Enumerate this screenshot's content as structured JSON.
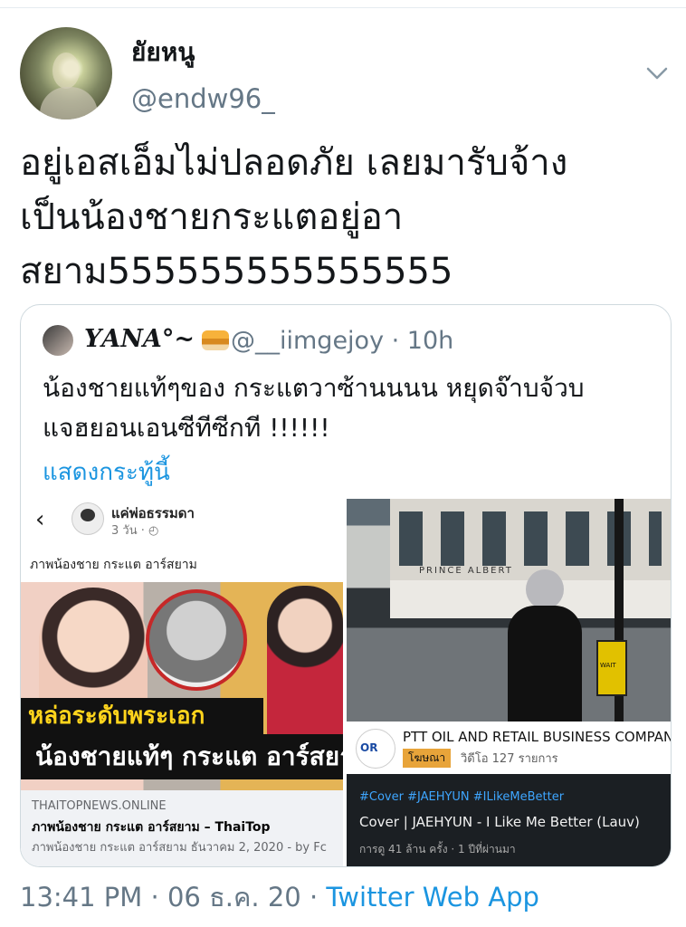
{
  "tweet": {
    "display_name": "ยัยหนู",
    "handle": "@endw96_",
    "text_lines": [
      "อยู่เอสเอ็มไม่ปลอดภัย เลยมารับจ้าง",
      "เป็นน้องชายกระแตอยู่อา",
      "สยาม555555555555555"
    ],
    "timestamp": "13:41 PM · 06 ธ.ค. 20 · ",
    "source": "Twitter Web App"
  },
  "quote": {
    "display_name": "𝒀𝑨𝑵𝑨°~",
    "handle_time": "@__iimgejoy · 10h",
    "text_lines": [
      "น้องชายแท้ๆของ กระแตวาซ้านนนน  หยุดจ๊าบจ้วบ",
      "แจฮยอนเอนซีทีซีกที !!!!!!"
    ],
    "show_more": "แสดงกระทู้นี้"
  },
  "left_card": {
    "page_name": "แค่พ่อธรรมดา",
    "time": "3 วัน · ◴",
    "caption": "ภาพน้องชาย กระแต อาร์สยาม",
    "banner_top": "หล่อระดับพระเอก",
    "banner_bottom": "น้องชายแท้ๆ กระแต อาร์สยาม",
    "domain": "THAITOPNEWS.ONLINE",
    "title": "ภาพน้องชาย กระแต อาร์สยาม – ThaiTop",
    "description": "ภาพน้องชาย กระแต อาร์สยาม ธันวาคม 2, 2020 - by Fc"
  },
  "right_card": {
    "sign": "PRINCE ALBERT",
    "logo_text": "OR",
    "channel_name": "PTT OIL AND RETAIL BUSINESS COMPAN",
    "ad_label": "โฆษณา",
    "video_count": "วิดีโอ 127 รายการ",
    "tags": "#Cover #JAEHYUN #ILikeMeBetter",
    "title": "Cover | JAEHYUN - I Like Me Better (Lauv)",
    "stats": "การดู 41 ล้าน ครั้ง · 1 ปีที่ผ่านมา",
    "box_label": "WAIT"
  }
}
